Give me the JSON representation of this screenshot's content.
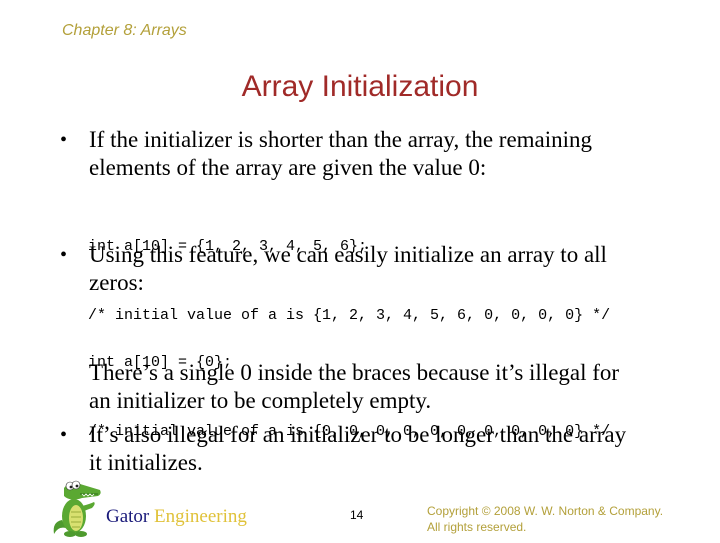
{
  "header": {
    "chapter": "Chapter 8: Arrays",
    "title": "Array Initialization"
  },
  "bullets": [
    {
      "marker": "•",
      "lines": [
        "If the initializer is shorter than the array, the remaining",
        "elements of the array are given the value 0:"
      ]
    },
    {
      "marker": "•",
      "lines": [
        "Using this feature, we can easily initialize an array to all",
        "zeros:"
      ]
    },
    {
      "marker": "",
      "lines": [
        "There’s a single 0 inside the braces because it’s illegal for",
        "an initializer to be completely empty."
      ]
    },
    {
      "marker": "•",
      "lines": [
        "It’s also illegal for an initializer to be longer than the array",
        "it initializes."
      ]
    }
  ],
  "code_blocks": [
    {
      "lines": [
        "int a[10] = {1, 2, 3, 4, 5, 6};",
        "/* initial value of a is {1, 2, 3, 4, 5, 6, 0, 0, 0, 0} */"
      ]
    },
    {
      "lines": [
        "int a[10] = {0};",
        "/* initial value of a is {0, 0, 0, 0, 0, 0, 0, 0, 0, 0} */"
      ]
    }
  ],
  "footer": {
    "logo_icon": "gator-mascot-icon",
    "brand_part1": "Gator",
    "brand_part2": "Engineering",
    "page_number": "14",
    "copyright_line1": "Copyright © 2008 W. W. Norton & Company.",
    "copyright_line2": "All rights reserved."
  },
  "colors": {
    "chapter": "#b3a03a",
    "title": "#a02a28",
    "brand_gator": "#1a1a7a",
    "brand_engineering": "#e0c23a",
    "copyright": "#b3a03a"
  }
}
